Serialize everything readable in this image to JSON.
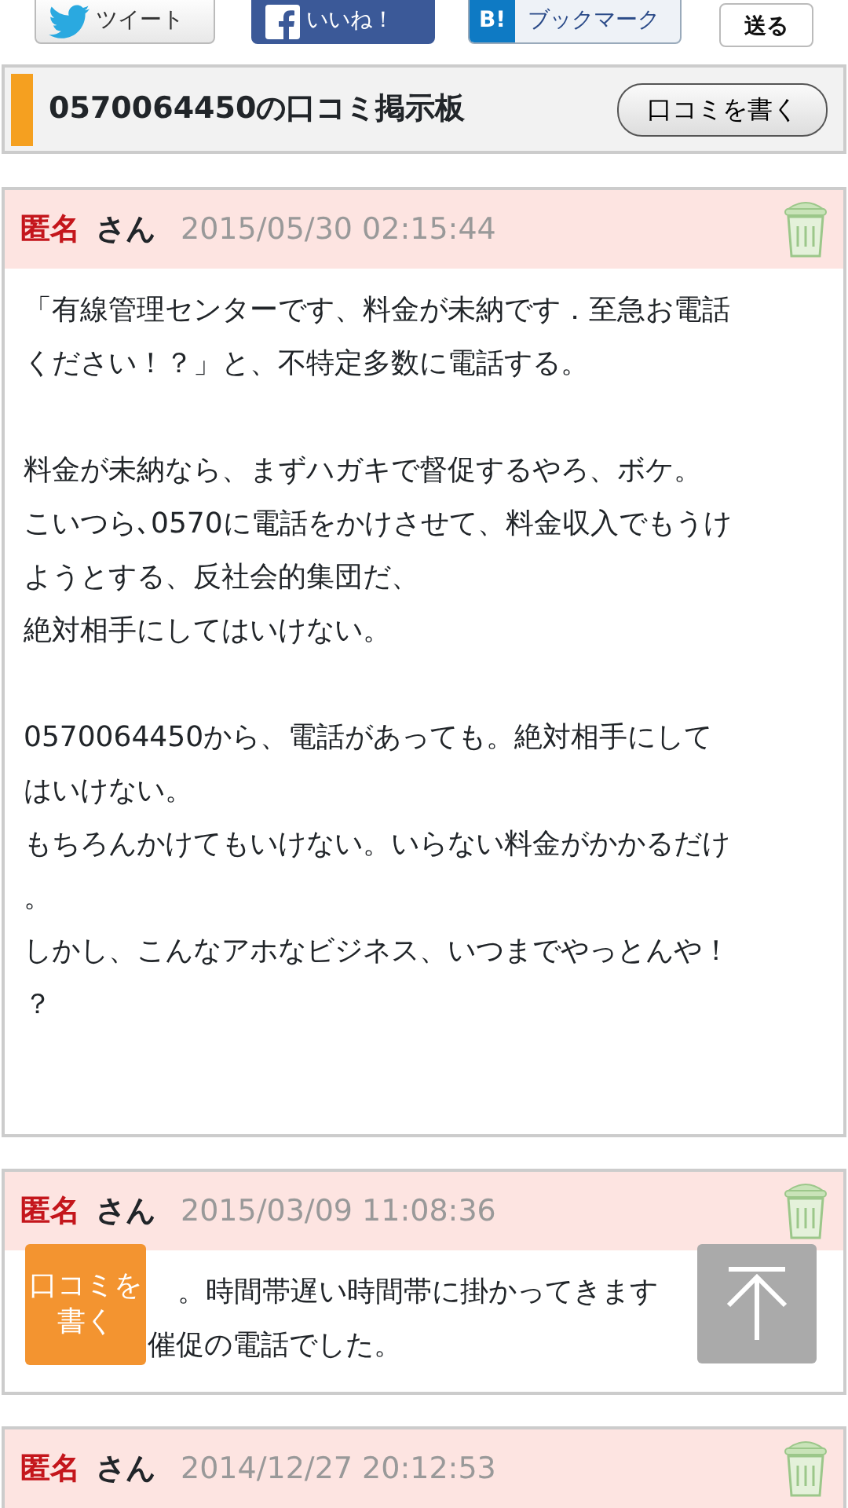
{
  "share_buttons": [
    {
      "kind": "twitter",
      "label": "ツイート"
    },
    {
      "kind": "facebook",
      "label": "いいね！"
    },
    {
      "kind": "hatena",
      "icon_text": "B!",
      "label": "ブックマーク"
    },
    {
      "kind": "send",
      "label": "送る"
    }
  ],
  "header": {
    "title": "0570064450の口コミ掲示板",
    "button": "口コミを書く"
  },
  "posts": [
    {
      "name": "匿名",
      "suffix": "さん",
      "date": "2015/05/30 02:15:44",
      "cut_off_left": false,
      "paragraphs": [
        [
          "「有線管理センターです、料金が未納です．至急お電話",
          "ください！？」と、不特定多数に電話する。"
        ],
        [
          "料金が未納なら、まずハガキで督促するやろ、ボケ。",
          "こいつら､0570に電話をかけさせて、料金収入でもうけ",
          "ようとする、反社会的集団だ、",
          "絶対相手にしてはいけない。"
        ],
        [
          "0570064450から、電話があっても。絶対相手にして",
          "はいけない。",
          "もちろんかけてもいけない。いらない料金がかかるだけ",
          "。",
          "しかし、こんなアホなビジネス、いつまでやっとんや！",
          "？"
        ]
      ]
    },
    {
      "name": "匿名",
      "suffix": "さん",
      "date": "2015/03/09 11:08:36",
      "cut_off_left": true,
      "paragraphs": [
        [
          "。時間帯遅い時間帯に掛かってきます",
          "催促の電話でした。"
        ]
      ]
    },
    {
      "name": "匿名",
      "suffix": "さん",
      "date": "2014/12/27 20:12:53",
      "cut_off_left": false
    }
  ],
  "floating_write_button": "口コミを書く"
}
